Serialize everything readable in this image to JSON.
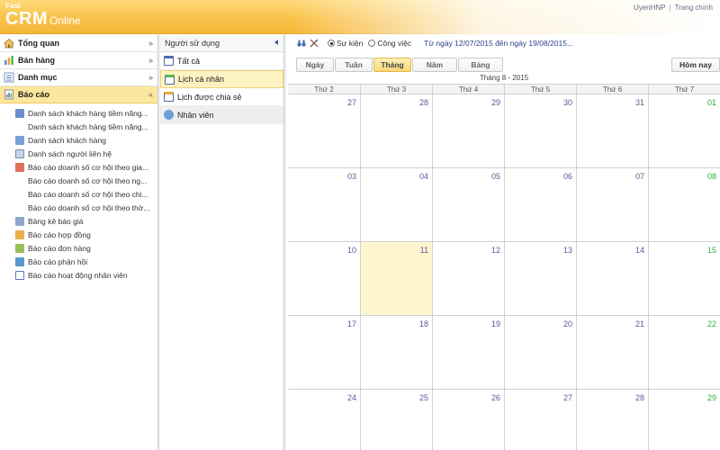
{
  "header": {
    "logo_small": "Fast",
    "logo_main": "CRM",
    "logo_sub": "Online",
    "user_link": "UyenHNP",
    "home_link": "Trang chính"
  },
  "sidebar": {
    "items": [
      {
        "label": "Tổng quan",
        "icon": "home-icon",
        "chevron": "»"
      },
      {
        "label": "Bán hàng",
        "icon": "sales-icon",
        "chevron": "»"
      },
      {
        "label": "Danh mục",
        "icon": "catalog-icon",
        "chevron": "»"
      },
      {
        "label": "Báo cáo",
        "icon": "report-icon",
        "chevron": "«",
        "active": true
      }
    ],
    "sub_items": [
      {
        "label": "Danh sách khách hàng tiềm năng...",
        "icon": "list-icon"
      },
      {
        "label": "Danh sách khách hàng tiềm năng...",
        "icon": ""
      },
      {
        "label": "Danh sách khách hàng",
        "icon": "customers-icon"
      },
      {
        "label": "Danh sách người liên hệ",
        "icon": "contact-icon"
      },
      {
        "label": "Báo cáo doanh số cơ hội theo gia...",
        "icon": "chart-icon"
      },
      {
        "label": "Báo cáo doanh số cơ hội theo ng...",
        "icon": ""
      },
      {
        "label": "Báo cáo doanh số cơ hội theo chi...",
        "icon": ""
      },
      {
        "label": "Báo cáo doanh số cơ hội theo thờ...",
        "icon": ""
      },
      {
        "label": "Bảng kê báo giá",
        "icon": "quote-icon"
      },
      {
        "label": "Báo cáo hợp đồng",
        "icon": "contract-icon"
      },
      {
        "label": "Báo cáo đơn hàng",
        "icon": "order-icon"
      },
      {
        "label": "Báo cáo phản hồi",
        "icon": "feedback-icon"
      },
      {
        "label": "Báo cáo hoạt động nhân viên",
        "icon": "activity-icon"
      }
    ]
  },
  "mid": {
    "title": "Người sử dụng",
    "items": [
      {
        "label": "Tất cả",
        "icon": "calendar-icon"
      },
      {
        "label": "Lịch cá nhân",
        "icon": "personal-calendar-icon",
        "active": true
      },
      {
        "label": "Lịch được chia sẻ",
        "icon": "shared-calendar-icon"
      },
      {
        "label": "Nhân viên",
        "icon": "employees-icon",
        "grey": true
      }
    ]
  },
  "calendar": {
    "radio_event": "Sự kiện",
    "radio_task": "Công việc",
    "range": "Từ ngày 12/07/2015 đến ngày 19/08/2015...",
    "views": [
      "Ngày",
      "Tuần",
      "Tháng",
      "Năm",
      "Bảng"
    ],
    "active_view": "Tháng",
    "today_button": "Hôm nay",
    "month_title": "Tháng 8 - 2015",
    "weekdays": [
      "Thứ 2",
      "Thứ 3",
      "Thứ 4",
      "Thứ 5",
      "Thứ 6",
      "Thứ 7"
    ],
    "weeks": [
      [
        "27",
        "28",
        "29",
        "30",
        "31",
        "01"
      ],
      [
        "03",
        "04",
        "05",
        "06",
        "07",
        "08"
      ],
      [
        "10",
        "11",
        "12",
        "13",
        "14",
        "15"
      ],
      [
        "17",
        "18",
        "19",
        "20",
        "21",
        "22"
      ],
      [
        "24",
        "25",
        "26",
        "27",
        "28",
        "29"
      ]
    ],
    "today_date": "11",
    "colors": {
      "day_number": "#6a4f9a",
      "weekend": "#2eaf3a",
      "today_bg": "#fdf6cf"
    }
  }
}
